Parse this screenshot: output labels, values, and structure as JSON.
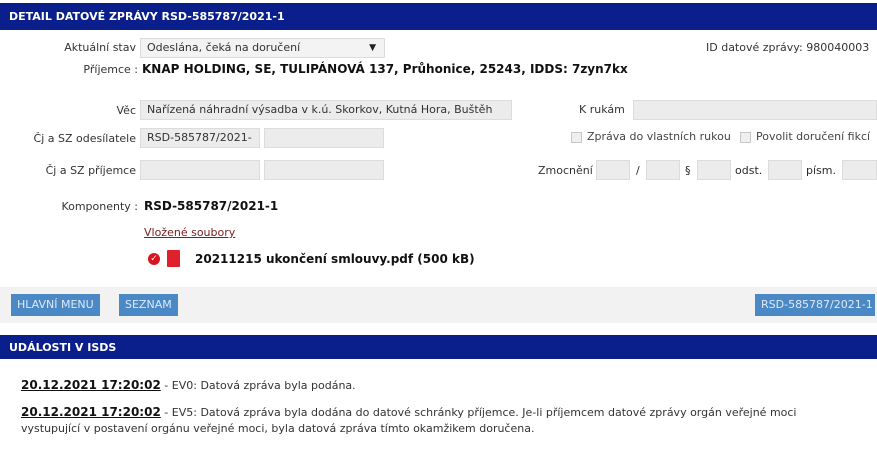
{
  "detail": {
    "title": "DETAIL DATOVÉ ZPRÁVY RSD-585787/2021-1",
    "state_label": "Aktuální stav",
    "state_value": "Odeslána, čeká na doručení",
    "message_id_label": "ID datové zprávy:",
    "message_id": "980040003",
    "recipient_label": "Příjemce :",
    "recipient_value": "KNAP HOLDING, SE, TULIPÁNOVÁ 137, Průhonice, 25243, IDDS: 7zyn7kx",
    "subject_label": "Věc",
    "subject_value": "Nařízená náhradní výsadba v k.ú. Skorkov, Kutná Hora, Buštěh",
    "to_hands_label": "K rukám",
    "to_hands_value": "",
    "sender_ref_label": "Čj a SZ odesílatele",
    "sender_ref_value": "RSD-585787/2021-",
    "sender_ref_value2": "",
    "own_hands_label": "Zpráva do vlastních rukou",
    "fiction_label": "Povolit doručení fikcí",
    "recipient_ref_label": "Čj a SZ příjemce",
    "recipient_ref_value": "",
    "recipient_ref_value2": "",
    "authorization_label": "Zmocnění",
    "slash": "/",
    "paragraph": "§",
    "odst_label": "odst.",
    "pism_label": "písm.",
    "components_label": "Komponenty :",
    "components_value": "RSD-585787/2021-1",
    "attached_files_link": "Vložené soubory",
    "file_name": "20211215 ukončení smlouvy.pdf (500 kB)"
  },
  "buttons": {
    "main_menu": "HLAVNÍ MENU",
    "list": "SEZNAM",
    "ref": "RSD-585787/2021-1"
  },
  "events": {
    "title": "UDÁLOSTI V ISDS",
    "items": [
      {
        "time": "20.12.2021 17:20:02",
        "code": "EV0",
        "text": "Datová zpráva byla podána."
      },
      {
        "time": "20.12.2021 17:20:02",
        "code": "EV5",
        "text": "Datová zpráva byla dodána do datové schránky příjemce. Je-li příjemcem datové zprávy orgán veřejné moci",
        "text2": "vystupující v postavení orgánu veřejné moci, byla datová zpráva tímto okamžikem doručena."
      }
    ]
  },
  "colors": {
    "header": "#0b1f8c",
    "button": "#4a88c6",
    "field": "#ececec"
  },
  "icons": [
    "delete-icon",
    "pdf-file-icon",
    "dropdown-arrow-icon"
  ]
}
